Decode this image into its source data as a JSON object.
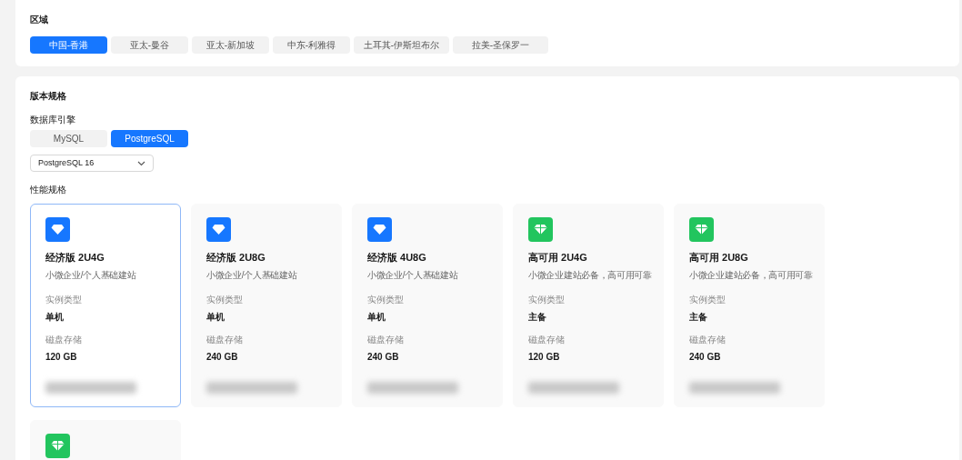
{
  "region": {
    "title": "区域",
    "options": [
      {
        "label": "中国-香港",
        "selected": true
      },
      {
        "label": "亚太-曼谷",
        "selected": false
      },
      {
        "label": "亚太-新加坡",
        "selected": false
      },
      {
        "label": "中东-利雅得",
        "selected": false
      },
      {
        "label": "土耳其-伊斯坦布尔",
        "selected": false
      },
      {
        "label": "拉美-圣保罗一",
        "selected": false
      }
    ]
  },
  "spec": {
    "title": "版本规格",
    "engine_label": "数据库引擎",
    "engines": [
      {
        "label": "MySQL",
        "selected": false
      },
      {
        "label": "PostgreSQL",
        "selected": true
      }
    ],
    "version": {
      "value": "PostgreSQL 16"
    },
    "perf_label": "性能规格",
    "plans": [
      {
        "kind": "economy",
        "selected": true,
        "name": "经济版 2U4G",
        "desc": "小微企业/个人基础建站",
        "type_label": "实例类型",
        "type": "单机",
        "disk_label": "磁盘存储",
        "disk": "120 GB"
      },
      {
        "kind": "economy",
        "selected": false,
        "name": "经济版 2U8G",
        "desc": "小微企业/个人基础建站",
        "type_label": "实例类型",
        "type": "单机",
        "disk_label": "磁盘存储",
        "disk": "240 GB"
      },
      {
        "kind": "economy",
        "selected": false,
        "name": "经济版 4U8G",
        "desc": "小微企业/个人基础建站",
        "type_label": "实例类型",
        "type": "单机",
        "disk_label": "磁盘存储",
        "disk": "240 GB"
      },
      {
        "kind": "ha",
        "selected": false,
        "name": "高可用 2U4G",
        "desc": "小微企业建站必备，高可用可靠",
        "type_label": "实例类型",
        "type": "主备",
        "disk_label": "磁盘存储",
        "disk": "120 GB"
      },
      {
        "kind": "ha",
        "selected": false,
        "name": "高可用 2U8G",
        "desc": "小微企业建站必备，高可用可靠",
        "type_label": "实例类型",
        "type": "主备",
        "disk_label": "磁盘存储",
        "disk": "240 GB"
      },
      {
        "kind": "ha",
        "selected": false
      }
    ]
  }
}
